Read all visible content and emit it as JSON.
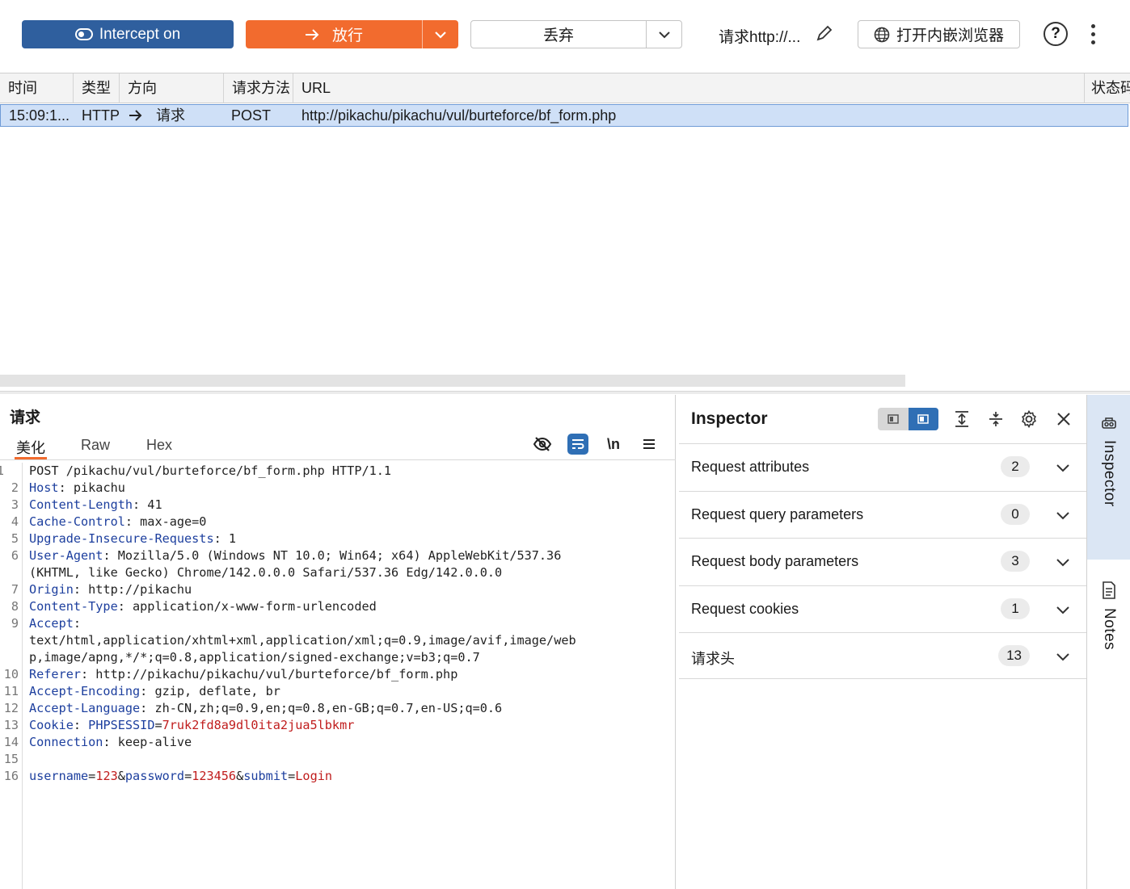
{
  "toolbar": {
    "intercept_label": "Intercept on",
    "forward_label": "放行",
    "drop_label": "丢弃",
    "request_label": "请求http://...",
    "browser_label": "打开内嵌浏览器",
    "help_glyph": "?"
  },
  "table": {
    "columns": [
      "时间",
      "类型",
      "方向",
      "请求方法",
      "URL",
      "状态码"
    ],
    "rows": [
      {
        "time": "15:09:1...",
        "type": "HTTP",
        "direction": "请求",
        "method": "POST",
        "url": "http://pikachu/pikachu/vul/burteforce/bf_form.php"
      }
    ]
  },
  "editor": {
    "title": "请求",
    "tabs": [
      "美化",
      "Raw",
      "Hex"
    ],
    "newline_label": "\\n",
    "lines": [
      {
        "n": "1",
        "segs": [
          [
            "v",
            "POST /pikachu/vul/burteforce/bf_form.php HTTP/1.1"
          ]
        ]
      },
      {
        "n": "2",
        "segs": [
          [
            "k",
            "Host"
          ],
          [
            "v",
            ": pikachu"
          ]
        ]
      },
      {
        "n": "3",
        "segs": [
          [
            "k",
            "Content-Length"
          ],
          [
            "v",
            ": 41"
          ]
        ]
      },
      {
        "n": "4",
        "segs": [
          [
            "k",
            "Cache-Control"
          ],
          [
            "v",
            ": max-age=0"
          ]
        ]
      },
      {
        "n": "5",
        "segs": [
          [
            "k",
            "Upgrade-Insecure-Requests"
          ],
          [
            "v",
            ": 1"
          ]
        ]
      },
      {
        "n": "6",
        "segs": [
          [
            "k",
            "User-Agent"
          ],
          [
            "v",
            ": Mozilla/5.0 (Windows NT 10.0; Win64; x64) AppleWebKit/537.36"
          ]
        ]
      },
      {
        "n": "",
        "segs": [
          [
            "v",
            "(KHTML, like Gecko) Chrome/142.0.0.0 Safari/537.36 Edg/142.0.0.0"
          ]
        ]
      },
      {
        "n": "7",
        "segs": [
          [
            "k",
            "Origin"
          ],
          [
            "v",
            ": http://pikachu"
          ]
        ]
      },
      {
        "n": "8",
        "segs": [
          [
            "k",
            "Content-Type"
          ],
          [
            "v",
            ": application/x-www-form-urlencoded"
          ]
        ]
      },
      {
        "n": "9",
        "segs": [
          [
            "k",
            "Accept"
          ],
          [
            "v",
            ":"
          ]
        ]
      },
      {
        "n": "",
        "segs": [
          [
            "v",
            "text/html,application/xhtml+xml,application/xml;q=0.9,image/avif,image/web"
          ]
        ]
      },
      {
        "n": "",
        "segs": [
          [
            "v",
            "p,image/apng,*/*;q=0.8,application/signed-exchange;v=b3;q=0.7"
          ]
        ]
      },
      {
        "n": "10",
        "segs": [
          [
            "k",
            "Referer"
          ],
          [
            "v",
            ": http://pikachu/pikachu/vul/burteforce/bf_form.php"
          ]
        ]
      },
      {
        "n": "11",
        "segs": [
          [
            "k",
            "Accept-Encoding"
          ],
          [
            "v",
            ": gzip, deflate, br"
          ]
        ]
      },
      {
        "n": "12",
        "segs": [
          [
            "k",
            "Accept-Language"
          ],
          [
            "v",
            ": zh-CN,zh;q=0.9,en;q=0.8,en-GB;q=0.7,en-US;q=0.6"
          ]
        ]
      },
      {
        "n": "13",
        "segs": [
          [
            "k",
            "Cookie"
          ],
          [
            "v",
            ": "
          ],
          [
            "k",
            "PHPSESSID"
          ],
          [
            "v",
            "="
          ],
          [
            "r",
            "7ruk2fd8a9dl0ita2jua5lbkmr"
          ]
        ]
      },
      {
        "n": "14",
        "segs": [
          [
            "k",
            "Connection"
          ],
          [
            "v",
            ": keep-alive"
          ]
        ]
      },
      {
        "n": "15",
        "segs": []
      },
      {
        "n": "16",
        "segs": [
          [
            "k",
            "username"
          ],
          [
            "v",
            "="
          ],
          [
            "r",
            "123"
          ],
          [
            "v",
            "&"
          ],
          [
            "k",
            "password"
          ],
          [
            "v",
            "="
          ],
          [
            "r",
            "123456"
          ],
          [
            "v",
            "&"
          ],
          [
            "k",
            "submit"
          ],
          [
            "v",
            "="
          ],
          [
            "r",
            "Login"
          ]
        ]
      }
    ]
  },
  "inspector": {
    "title": "Inspector",
    "sections": [
      {
        "label": "Request attributes",
        "count": "2"
      },
      {
        "label": "Request query parameters",
        "count": "0"
      },
      {
        "label": "Request body parameters",
        "count": "3"
      },
      {
        "label": "Request cookies",
        "count": "1"
      },
      {
        "label": "请求头",
        "count": "13"
      }
    ]
  },
  "sidebar": {
    "tabs": [
      "Inspector",
      "Notes"
    ]
  },
  "colors": {
    "intercept_bg": "#2f5f9e",
    "forward_bg": "#f26b2e",
    "selected_row": "#cfe0f7",
    "header_key": "#1d3f9e",
    "param_value": "#c01d1d"
  }
}
